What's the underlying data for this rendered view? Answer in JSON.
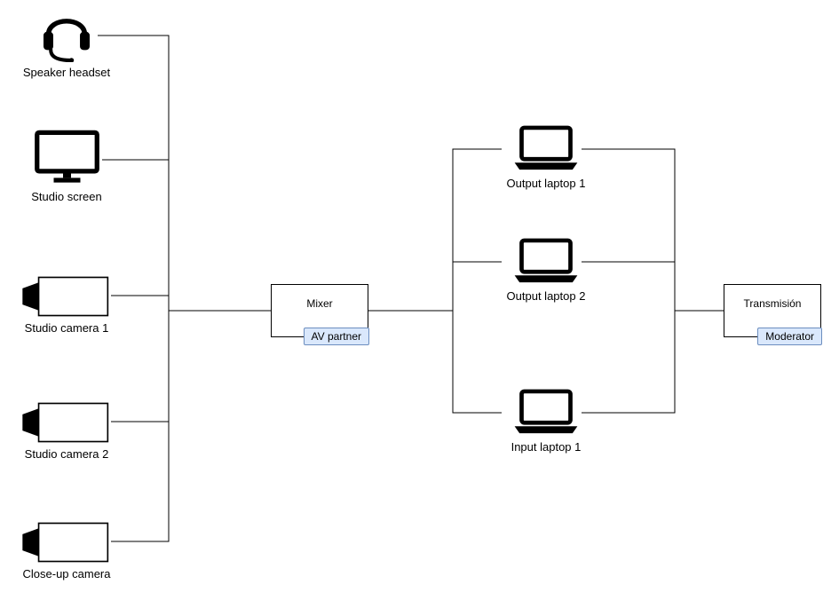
{
  "nodes": {
    "headset": {
      "label": "Speaker headset"
    },
    "screen": {
      "label": "Studio screen"
    },
    "cam1": {
      "label": "Studio camera 1"
    },
    "cam2": {
      "label": "Studio camera 2"
    },
    "cam3": {
      "label": "Close-up camera"
    },
    "mixer": {
      "label": "Mixer",
      "tag": "AV partner"
    },
    "out_laptop_1": {
      "label": "Output laptop 1"
    },
    "out_laptop_2": {
      "label": "Output laptop 2"
    },
    "in_laptop_1": {
      "label": "Input laptop 1"
    },
    "transmision": {
      "label": "Transmisión",
      "tag": "Moderator"
    }
  },
  "connections": [
    [
      "headset",
      "mixer"
    ],
    [
      "screen",
      "mixer"
    ],
    [
      "cam1",
      "mixer"
    ],
    [
      "cam2",
      "mixer"
    ],
    [
      "cam3",
      "mixer"
    ],
    [
      "mixer",
      "out_laptop_1"
    ],
    [
      "mixer",
      "out_laptop_2"
    ],
    [
      "mixer",
      "in_laptop_1"
    ],
    [
      "out_laptop_1",
      "transmision"
    ],
    [
      "out_laptop_2",
      "transmision"
    ],
    [
      "in_laptop_1",
      "transmision"
    ]
  ]
}
